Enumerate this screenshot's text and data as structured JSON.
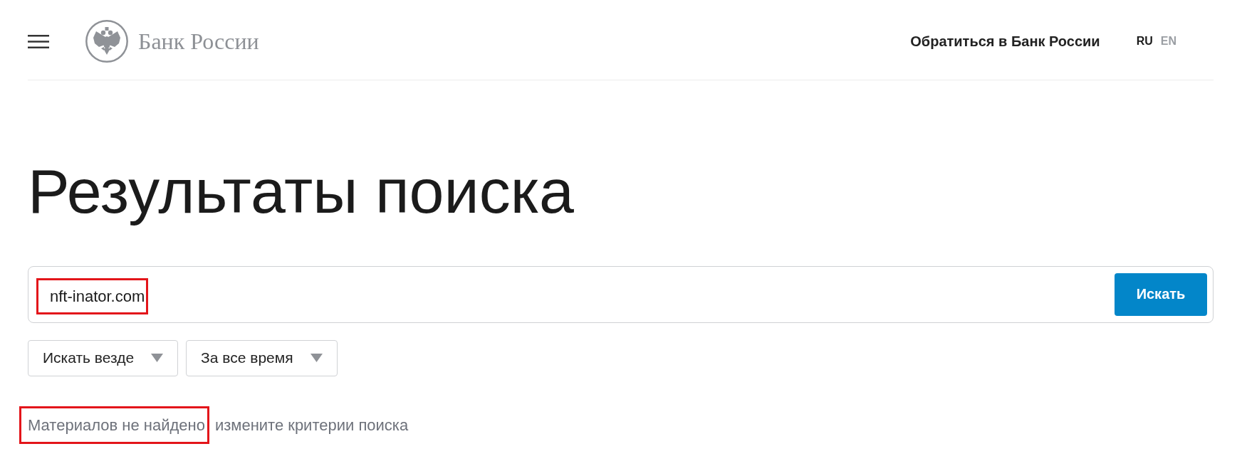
{
  "header": {
    "logo_text": "Банк России",
    "contact_link": "Обратиться в Банк России",
    "languages": [
      {
        "label": "RU",
        "selected": true
      },
      {
        "label": "EN",
        "selected": false
      }
    ]
  },
  "title": "Результаты поиска",
  "search": {
    "value": "nft-inator.com",
    "highlighted": true,
    "button": "Искать"
  },
  "filters": [
    {
      "label": "Искать везде"
    },
    {
      "label": "За все время"
    }
  ],
  "message": [
    {
      "text": "Материалов не найдено",
      "highlighted": true
    },
    {
      "text": "измените критерии поиска",
      "highlighted": false
    }
  ]
}
